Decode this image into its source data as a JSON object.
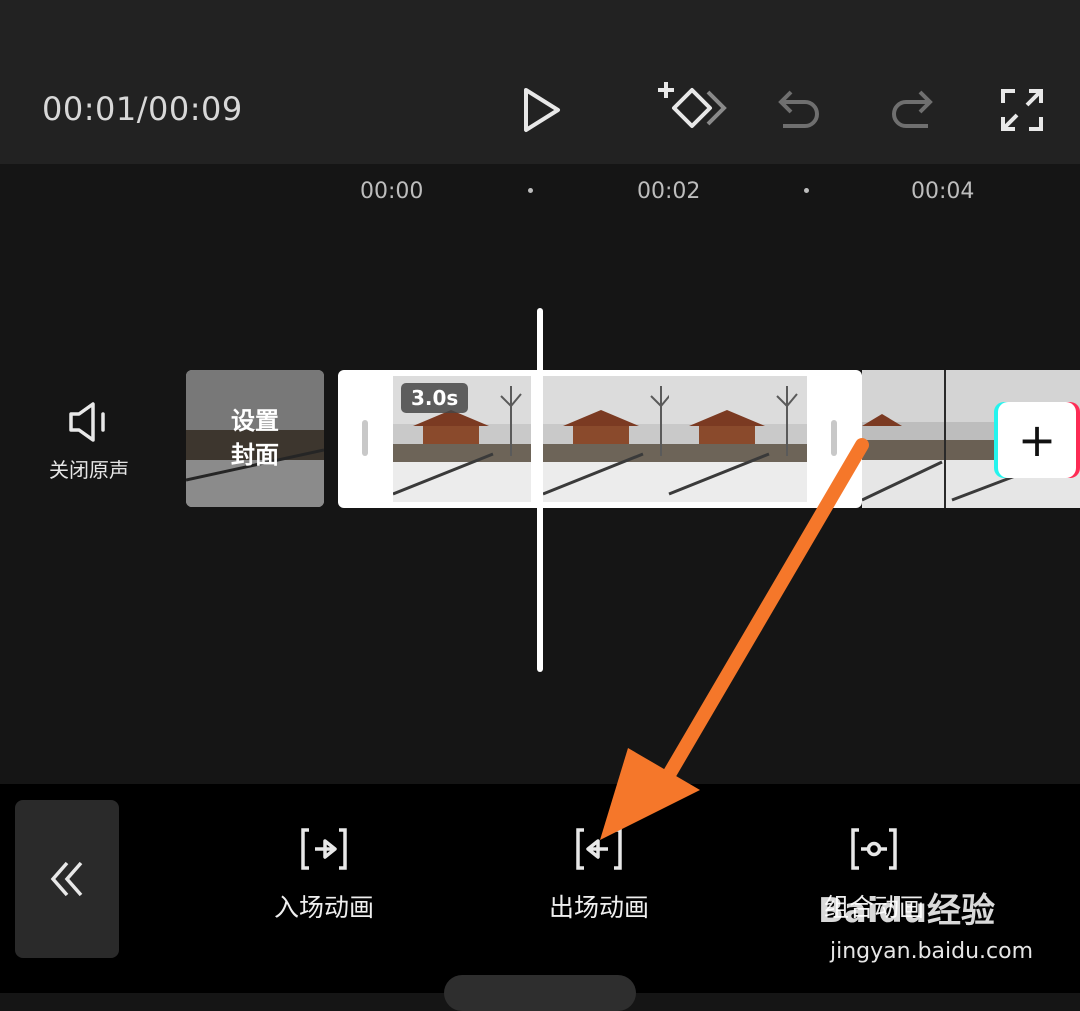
{
  "topbar": {
    "time": "00:01/00:09",
    "icons": [
      "play-icon",
      "add-keyframe-icon",
      "undo-icon",
      "redo-icon",
      "fullscreen-icon"
    ]
  },
  "timeline": {
    "ruler": [
      "00:00",
      "00:02",
      "00:04"
    ],
    "mute_label": "关闭原声",
    "cover_label_line1": "设置",
    "cover_label_line2": "封面",
    "clip_duration": "3.0s",
    "add_clip_symbol": "+"
  },
  "bottom": {
    "collapse_symbol": "«",
    "buttons": [
      {
        "label": "入场动画",
        "icon": "entrance-animation-icon"
      },
      {
        "label": "出场动画",
        "icon": "exit-animation-icon"
      },
      {
        "label": "组合动画",
        "icon": "combo-animation-icon"
      }
    ]
  },
  "annotation": {
    "arrow_color": "#f5772a"
  },
  "watermark": {
    "logo": "Baidu经验",
    "url": "jingyan.baidu.com"
  }
}
